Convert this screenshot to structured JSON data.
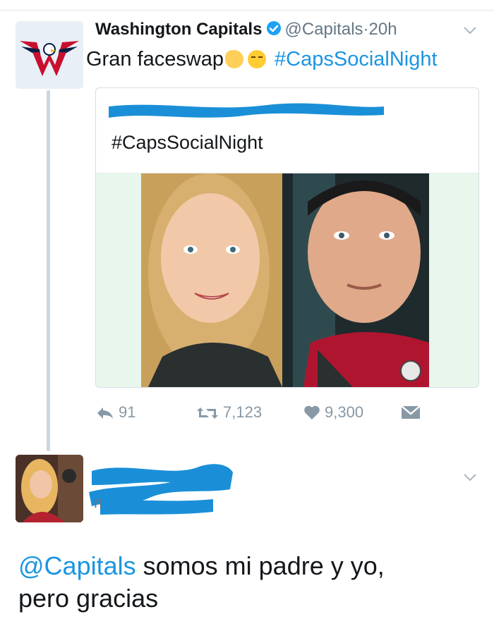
{
  "tweet": {
    "display_name": "Washington Capitals",
    "handle": "@Capitals",
    "separator": "·",
    "time": "20h",
    "text": "Gran faceswap",
    "hashtag": "#CapsSocialNight"
  },
  "quoted_card": {
    "hashtag": "#CapsSocialNight"
  },
  "actions": {
    "replies": "91",
    "retweets": "7,123",
    "likes": "9,300"
  },
  "reply": {
    "name_fragment": "n",
    "mention": "@Capitals",
    "text_line1": "somos mi padre y yo,",
    "text_line2": "pero gracias"
  },
  "colors": {
    "link": "#1b95e0",
    "redaction": "#1a8fd8",
    "muted": "#8899a6"
  }
}
